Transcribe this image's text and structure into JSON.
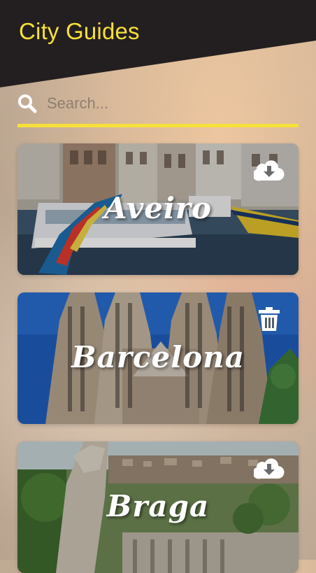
{
  "header": {
    "title": "City Guides",
    "title_color": "#f6e03a",
    "background": "#231f20"
  },
  "search": {
    "placeholder": "Search...",
    "value": "",
    "icon": "search-icon",
    "underline_color": "#f6e03a"
  },
  "cities": [
    {
      "name": "Aveiro",
      "action": "download",
      "action_icon": "cloud-download-icon"
    },
    {
      "name": "Barcelona",
      "action": "delete",
      "action_icon": "trash-icon"
    },
    {
      "name": "Braga",
      "action": "download",
      "action_icon": "cloud-download-icon"
    }
  ]
}
